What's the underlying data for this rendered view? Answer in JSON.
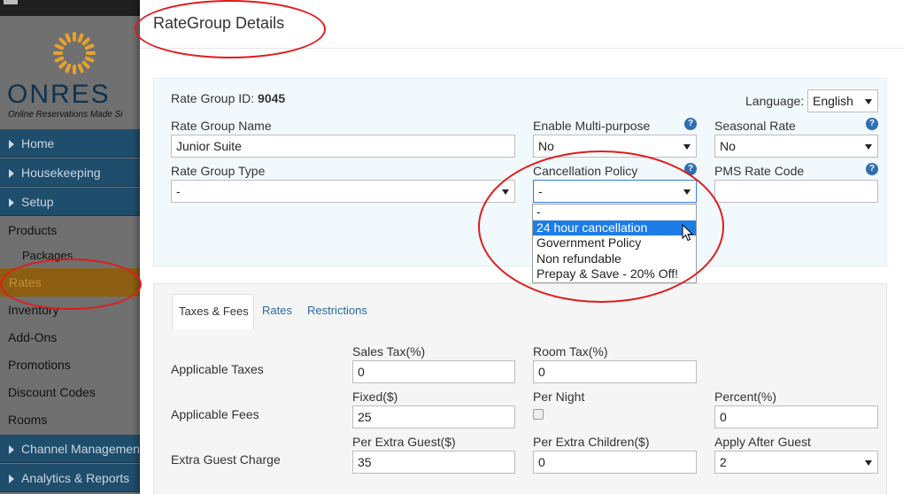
{
  "sidebar": {
    "logo_text": "ONRES",
    "logo_tagline": "Online Reservations Made Si",
    "items": [
      {
        "label": "Home",
        "kind": "section"
      },
      {
        "label": "Housekeeping",
        "kind": "section"
      },
      {
        "label": "Setup",
        "kind": "section"
      },
      {
        "label": "Products",
        "kind": "link"
      },
      {
        "label": "Packages",
        "kind": "sublink"
      },
      {
        "label": "Rates",
        "kind": "link",
        "active": true
      },
      {
        "label": "Inventory",
        "kind": "link"
      },
      {
        "label": "Add-Ons",
        "kind": "link"
      },
      {
        "label": "Promotions",
        "kind": "link"
      },
      {
        "label": "Discount Codes",
        "kind": "link"
      },
      {
        "label": "Rooms",
        "kind": "link"
      },
      {
        "label": "Channel Management",
        "kind": "section"
      },
      {
        "label": "Analytics & Reports",
        "kind": "section"
      }
    ]
  },
  "modal": {
    "title": "RateGroup Details",
    "rate_group_id_label": "Rate Group ID:",
    "rate_group_id": "9045",
    "language_label": "Language:",
    "language_value": "English",
    "fields": {
      "name_label": "Rate Group Name",
      "name_value": "Junior Suite",
      "multipurpose_label": "Enable Multi-purpose",
      "multipurpose_value": "No",
      "seasonal_label": "Seasonal Rate",
      "seasonal_value": "No",
      "type_label": "Rate Group Type",
      "type_value": "-",
      "cancellation_label": "Cancellation Policy",
      "cancellation_value": "-",
      "pms_label": "PMS Rate Code",
      "pms_value": ""
    },
    "cancellation_options": [
      "-",
      "24 hour cancellation",
      "Government Policy",
      "Non refundable",
      "Prepay & Save - 20% Off!"
    ],
    "cancellation_highlighted": "24 hour cancellation",
    "help_glyph": "?",
    "tabs": [
      "Taxes & Fees",
      "Rates",
      "Restrictions"
    ],
    "active_tab": "Taxes & Fees",
    "taxes": {
      "row_label": "Applicable Taxes",
      "sales_label": "Sales Tax(%)",
      "sales_value": "0",
      "room_label": "Room Tax(%)",
      "room_value": "0"
    },
    "fees": {
      "row_label": "Applicable Fees",
      "fixed_label": "Fixed($)",
      "fixed_value": "25",
      "per_night_label": "Per Night",
      "per_night_checked": false,
      "percent_label": "Percent(%)",
      "percent_value": "0"
    },
    "extra_guest": {
      "row_label": "Extra Guest Charge",
      "per_guest_label": "Per Extra Guest($)",
      "per_guest_value": "35",
      "per_children_label": "Per Extra Children($)",
      "per_children_value": "0",
      "apply_after_label": "Apply After Guest",
      "apply_after_value": "2"
    }
  },
  "colors": {
    "annotation": "#e01b1b",
    "nav_section_bg": "#1f4d6c",
    "active_nav_bg": "#8c5e12",
    "highlight": "#1e7ce6",
    "link": "#2a6aa3",
    "logo_sun": "#e8a22a"
  }
}
